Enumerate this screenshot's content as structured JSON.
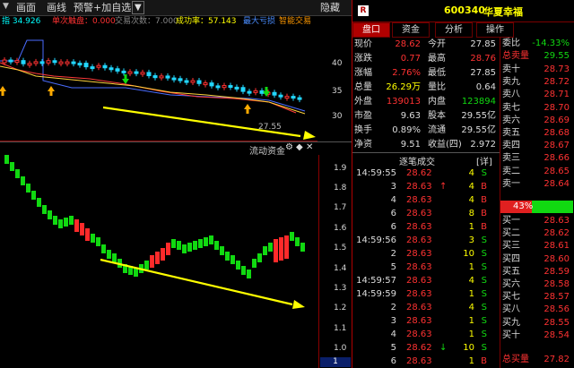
{
  "toolbar": {
    "items": [
      "画面",
      "画线",
      "预警",
      "+加自选"
    ],
    "hide_label": "隐藏"
  },
  "indicator_line": [
    {
      "text": "指 34.926",
      "color": "#00ffff"
    },
    {
      "text": "单次触盘：0.000",
      "color": "#ff3232"
    },
    {
      "text": "交易次数：7.000",
      "color": "#888888"
    },
    {
      "text": "成功率：57.143",
      "color": "#ffff00"
    },
    {
      "text": "最大亏损",
      "color": "#4a8dff"
    },
    {
      "text": "智能交易",
      "color": "#ff9900"
    }
  ],
  "price_axis": {
    "ticks": [
      "40",
      "35",
      "30"
    ]
  },
  "price_chart": {
    "last_label": "27.55"
  },
  "flow_panel": {
    "title": "流动资金",
    "axis_ticks": [
      "1.9",
      "1.8",
      "1.7",
      "1.6",
      "1.5",
      "1.4",
      "1.3",
      "1.2",
      "1.1",
      "1.0"
    ],
    "page": "1"
  },
  "stock": {
    "tag": "R",
    "code": "600340",
    "name": "华夏幸福"
  },
  "tabs": [
    "盘口",
    "资金",
    "分析",
    "操作"
  ],
  "quote": {
    "rows": [
      {
        "l1": "现价",
        "v1": "28.62",
        "c1": "#ff3232",
        "l2": "今开",
        "v2": "27.85",
        "c2": "#dddddd"
      },
      {
        "l1": "涨跌",
        "v1": "0.77",
        "c1": "#ff3232",
        "l2": "最高",
        "v2": "28.76",
        "c2": "#ff3232"
      },
      {
        "l1": "涨幅",
        "v1": "2.76%",
        "c1": "#ff3232",
        "l2": "最低",
        "v2": "27.85",
        "c2": "#dddddd"
      },
      {
        "l1": "总量",
        "v1": "26.29万",
        "c1": "#ffff00",
        "l2": "量比",
        "v2": "0.64",
        "c2": "#dddddd"
      },
      {
        "l1": "外盘",
        "v1": "139013",
        "c1": "#ff3232",
        "l2": "内盘",
        "v2": "123894",
        "c2": "#11d911"
      },
      {
        "l1": "市盈",
        "v1": "9.63",
        "c1": "#dddddd",
        "l2": "股本",
        "v2": "29.55亿",
        "c2": "#dddddd"
      },
      {
        "l1": "换手",
        "v1": "0.89%",
        "c1": "#dddddd",
        "l2": "流通",
        "v2": "29.55亿",
        "c2": "#dddddd"
      },
      {
        "l1": "净资",
        "v1": "9.51",
        "c1": "#dddddd",
        "l2": "收益(四)",
        "v2": "2.972",
        "c2": "#dddddd"
      }
    ]
  },
  "trades": {
    "title": "逐笔成交",
    "detail_label": "[详]",
    "rows": [
      {
        "time": "14:59:55",
        "price": "28.62",
        "arrow": "",
        "vol": "4",
        "side": "S"
      },
      {
        "time": "3",
        "price": "28.63",
        "arrow": "↑",
        "vol": "4",
        "side": "B"
      },
      {
        "time": "4",
        "price": "28.63",
        "arrow": "",
        "vol": "4",
        "side": "B"
      },
      {
        "time": "6",
        "price": "28.63",
        "arrow": "",
        "vol": "8",
        "side": "B"
      },
      {
        "time": "6",
        "price": "28.63",
        "arrow": "",
        "vol": "1",
        "side": "B"
      },
      {
        "time": "14:59:56",
        "price": "28.63",
        "arrow": "",
        "vol": "3",
        "side": "S"
      },
      {
        "time": "2",
        "price": "28.63",
        "arrow": "",
        "vol": "10",
        "side": "S"
      },
      {
        "time": "5",
        "price": "28.63",
        "arrow": "",
        "vol": "1",
        "side": "S"
      },
      {
        "time": "14:59:57",
        "price": "28.63",
        "arrow": "",
        "vol": "4",
        "side": "S"
      },
      {
        "time": "14:59:59",
        "price": "28.63",
        "arrow": "",
        "vol": "1",
        "side": "S"
      },
      {
        "time": "2",
        "price": "28.63",
        "arrow": "",
        "vol": "4",
        "side": "S"
      },
      {
        "time": "3",
        "price": "28.63",
        "arrow": "",
        "vol": "1",
        "side": "S"
      },
      {
        "time": "4",
        "price": "28.63",
        "arrow": "",
        "vol": "1",
        "side": "S"
      },
      {
        "time": "5",
        "price": "28.62",
        "arrow": "↓",
        "vol": "10",
        "side": "S"
      },
      {
        "time": "6",
        "price": "28.63",
        "arrow": "",
        "vol": "1",
        "side": "B"
      }
    ]
  },
  "orderbook": {
    "weibi_label": "委比",
    "weibi_value": "-14.33%",
    "sell_total_label": "总卖量",
    "sell_total_value": "29.55",
    "sells": [
      {
        "label": "卖十",
        "price": "28.73"
      },
      {
        "label": "卖九",
        "price": "28.72"
      },
      {
        "label": "卖八",
        "price": "28.71"
      },
      {
        "label": "卖七",
        "price": "28.70"
      },
      {
        "label": "卖六",
        "price": "28.69"
      },
      {
        "label": "卖五",
        "price": "28.68"
      },
      {
        "label": "卖四",
        "price": "28.67"
      },
      {
        "label": "卖三",
        "price": "28.66"
      },
      {
        "label": "卖二",
        "price": "28.65"
      },
      {
        "label": "卖一",
        "price": "28.64"
      }
    ],
    "ratio_label": "43%",
    "ratio": 0.43,
    "buys": [
      {
        "label": "买一",
        "price": "28.63"
      },
      {
        "label": "买二",
        "price": "28.62"
      },
      {
        "label": "买三",
        "price": "28.61"
      },
      {
        "label": "买四",
        "price": "28.60"
      },
      {
        "label": "买五",
        "price": "28.59"
      },
      {
        "label": "买六",
        "price": "28.58"
      },
      {
        "label": "买七",
        "price": "28.57"
      },
      {
        "label": "买八",
        "price": "28.56"
      },
      {
        "label": "买九",
        "price": "28.55"
      },
      {
        "label": "买十",
        "price": "28.54"
      }
    ],
    "buy_total_label": "总买量",
    "buy_total_value": "27.82"
  },
  "colors": {
    "up": "#ff3232",
    "down": "#11d911",
    "accent": "#b00000",
    "arrow": "#ffff00"
  }
}
